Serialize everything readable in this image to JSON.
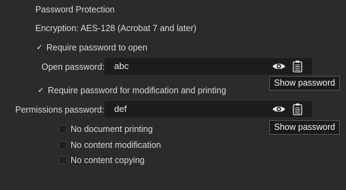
{
  "section_title": "Password Protection",
  "encryption": "Encryption: AES-128 (Acrobat 7 and later)",
  "require_open": {
    "label": "Require password to open",
    "checked": true
  },
  "open_password": {
    "label": "Open password:",
    "value": "abc"
  },
  "require_modify": {
    "label": "Require password for modification and printing",
    "checked": true
  },
  "permissions_password": {
    "label": "Permissions password:",
    "value": "def"
  },
  "tooltip": {
    "show_password": "Show password"
  },
  "permissions": [
    {
      "label": "No document printing",
      "checked": false
    },
    {
      "label": "No content modification",
      "checked": false
    },
    {
      "label": "No content copying",
      "checked": false
    }
  ],
  "checkmark": "✓",
  "icons": {
    "reveal": "eye-icon",
    "paste": "clipboard-icon"
  }
}
